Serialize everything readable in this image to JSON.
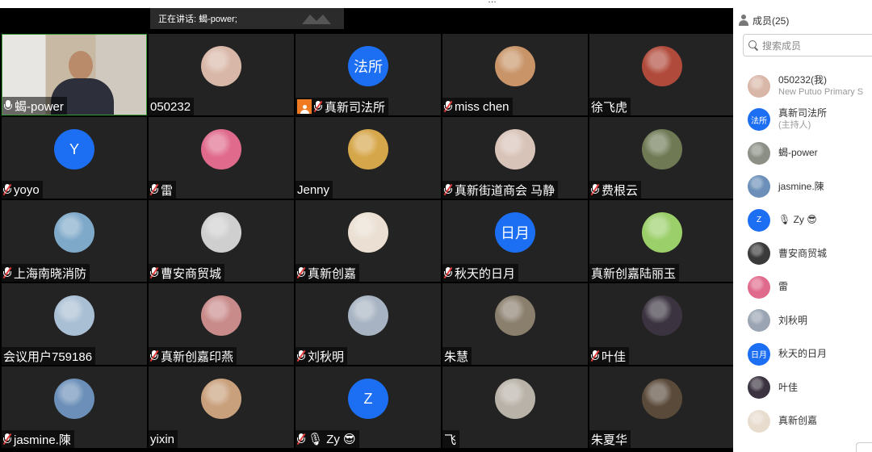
{
  "window": {
    "title": "…"
  },
  "speaker": {
    "label": "正在讲话: 蝎-power;"
  },
  "sidebar": {
    "header": "成员(25)",
    "search_placeholder": "搜索成员",
    "members": [
      {
        "name": "050232(我)",
        "sub": "New Putuo Primary S",
        "avatar": "photo-girl",
        "color": "#d9b7a8"
      },
      {
        "name": "真新司法所",
        "sub": "(主持人)",
        "avatar": "letter",
        "letter": "法所"
      },
      {
        "name": "蝎-power",
        "sub": "",
        "avatar": "photo-man",
        "color": "#8b8f86"
      },
      {
        "name": "jasmine.陳",
        "sub": "",
        "avatar": "photo-sunset",
        "color": "#6b8fb8"
      },
      {
        "name": "🎙 Zy 😎",
        "sub": "",
        "avatar": "letter",
        "letter": "Z"
      },
      {
        "name": "曹安商贸城",
        "sub": "",
        "avatar": "photo-sketch",
        "color": "#3a3a3a"
      },
      {
        "name": "雷",
        "sub": "",
        "avatar": "photo-flowers",
        "color": "#e06a8c"
      },
      {
        "name": "刘秋明",
        "sub": "",
        "avatar": "photo-cartoon",
        "color": "#9aa4b3"
      },
      {
        "name": "秋天的日月",
        "sub": "",
        "avatar": "letter",
        "letter": "日月"
      },
      {
        "name": "叶佳",
        "sub": "",
        "avatar": "photo-dark",
        "color": "#3b3440"
      },
      {
        "name": "真新创嘉",
        "sub": "",
        "avatar": "photo-drawing",
        "color": "#e8dccf"
      }
    ]
  },
  "tiles": [
    {
      "name": "蝎-power",
      "mic": "on",
      "avatar": "video",
      "color": "#c9c2b6"
    },
    {
      "name": "050232",
      "mic": "none",
      "avatar": "photo",
      "color": "#d9b7a8"
    },
    {
      "name": "真新司法所",
      "mic": "muted",
      "host": true,
      "avatar": "letter",
      "letter": "法所"
    },
    {
      "name": "miss chen",
      "mic": "muted",
      "avatar": "photo",
      "color": "#c89468"
    },
    {
      "name": "徐飞虎",
      "mic": "none",
      "avatar": "photo",
      "color": "#b04a3a"
    },
    {
      "name": "yoyo",
      "mic": "muted",
      "avatar": "letter",
      "letter": "Y"
    },
    {
      "name": "雷",
      "mic": "muted",
      "avatar": "photo",
      "color": "#e06a8c"
    },
    {
      "name": "Jenny",
      "mic": "none",
      "avatar": "photo",
      "color": "#d6a64a"
    },
    {
      "name": "真新街道商会 马静",
      "mic": "muted",
      "avatar": "photo",
      "color": "#d8c3b8"
    },
    {
      "name": "费根云",
      "mic": "muted",
      "avatar": "photo",
      "color": "#6f7a55"
    },
    {
      "name": "上海南晓消防",
      "mic": "muted",
      "avatar": "photo",
      "color": "#7fa9c9"
    },
    {
      "name": "曹安商贸城",
      "mic": "muted",
      "avatar": "photo",
      "color": "#cfcfcf"
    },
    {
      "name": "真新创嘉",
      "mic": "muted",
      "avatar": "photo",
      "color": "#eadfd2"
    },
    {
      "name": "秋天的日月",
      "mic": "muted",
      "avatar": "letter",
      "letter": "日月"
    },
    {
      "name": "真新创嘉陆丽玉",
      "mic": "none",
      "avatar": "photo",
      "color": "#9bcf6a"
    },
    {
      "name": "会议用户759186",
      "mic": "none",
      "avatar": "photo",
      "color": "#a9bfd4"
    },
    {
      "name": "真新创嘉印燕",
      "mic": "muted",
      "avatar": "photo",
      "color": "#c98a8a"
    },
    {
      "name": "刘秋明",
      "mic": "muted",
      "avatar": "photo",
      "color": "#a7b3c2"
    },
    {
      "name": "朱慧",
      "mic": "none",
      "avatar": "photo",
      "color": "#8a7e6c"
    },
    {
      "name": "叶佳",
      "mic": "muted",
      "avatar": "photo",
      "color": "#3b3440"
    },
    {
      "name": "jasmine.陳",
      "mic": "muted",
      "avatar": "photo",
      "color": "#6b8fb8"
    },
    {
      "name": "yixin",
      "mic": "none",
      "avatar": "photo",
      "color": "#c9a07c"
    },
    {
      "name": "🎙 Zy 😎",
      "mic": "muted",
      "avatar": "letter",
      "letter": "Z"
    },
    {
      "name": "飞",
      "mic": "none",
      "avatar": "photo",
      "color": "#b9b2a8"
    },
    {
      "name": "朱夏华",
      "mic": "none",
      "avatar": "photo",
      "color": "#5a4a3a"
    }
  ]
}
